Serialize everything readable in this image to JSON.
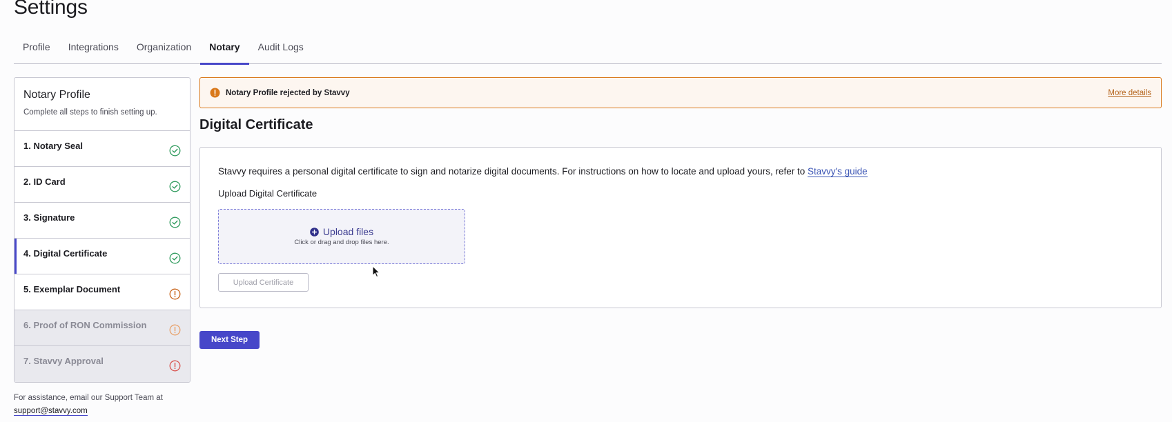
{
  "page": {
    "title": "Settings"
  },
  "tabs": [
    {
      "label": "Profile"
    },
    {
      "label": "Integrations"
    },
    {
      "label": "Organization"
    },
    {
      "label": "Notary"
    },
    {
      "label": "Audit Logs"
    }
  ],
  "active_tab": "Notary",
  "sidebar": {
    "title": "Notary Profile",
    "subtitle": "Complete all steps to finish setting up.",
    "steps": [
      {
        "label": "1. Notary Seal",
        "status": "complete",
        "icon": "check-circle-icon"
      },
      {
        "label": "2. ID Card",
        "status": "complete",
        "icon": "check-circle-icon"
      },
      {
        "label": "3. Signature",
        "status": "complete",
        "icon": "check-circle-icon"
      },
      {
        "label": "4. Digital Certificate",
        "status": "complete",
        "icon": "check-circle-icon"
      },
      {
        "label": "5. Exemplar Document",
        "status": "warning",
        "icon": "alert-circle-icon"
      },
      {
        "label": "6. Proof of RON Commission",
        "status": "disabled-warning",
        "icon": "alert-circle-icon"
      },
      {
        "label": "7. Stavvy Approval",
        "status": "disabled-error",
        "icon": "alert-circle-icon"
      }
    ],
    "active_step": "4. Digital Certificate"
  },
  "assist": {
    "text": "For assistance, email our Support Team at",
    "email": "support@stavvy.com"
  },
  "alert": {
    "message": "Notary Profile rejected by Stavvy",
    "link": "More details",
    "icon": "exclamation-circle-icon"
  },
  "section": {
    "title": "Digital Certificate"
  },
  "card": {
    "description": "Stavvy requires a personal digital certificate to sign and notarize digital documents. For instructions on how to locate and upload yours, refer to",
    "guide_link": "Stavvy's guide",
    "upload_label": "Upload Digital Certificate",
    "dropzone_title": "Upload files",
    "dropzone_hint": "Click or drag and drop files here.",
    "upload_button": "Upload Certificate"
  },
  "actions": {
    "next_step": "Next Step"
  },
  "colors": {
    "accent": "#4747c9",
    "success": "#2e9a5c",
    "warning": "#d9781a",
    "error": "#d9534f",
    "link": "#3a54b4"
  }
}
